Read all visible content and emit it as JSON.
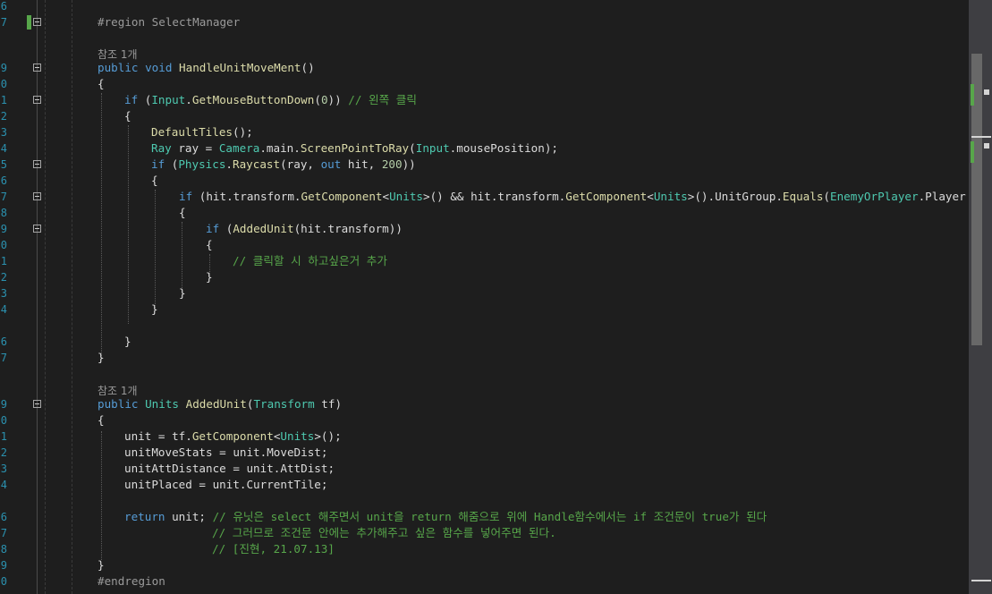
{
  "editor": {
    "line_numbers": [
      "6",
      "7",
      "",
      "9",
      "0",
      "1",
      "2",
      "3",
      "4",
      "5",
      "6",
      "7",
      "8",
      "9",
      "0",
      "1",
      "2",
      "3",
      "4",
      "",
      "6",
      "7",
      "",
      "9",
      "0",
      "1",
      "2",
      "3",
      "4",
      "",
      "6",
      "7",
      "8",
      "9",
      "0"
    ],
    "region_label": "#region SelectManager",
    "endregion_label": "#endregion",
    "reference_label_1": "참조 1개",
    "reference_label_2": "참조 1개",
    "comment_left_click": "// 왼쪽 클릭",
    "comment_on_click": "// 클릭할 시 하고싶은거 추가",
    "comment_return_1": "// 유닛은 select 해주면서 unit을 return 해줌으로 위에 Handle함수에서는 if 조건문이 true가 된다",
    "comment_return_2": "// 그러므로 조건문 안에는 추가해주고 싶은 함수를 넣어주면 된다.",
    "comment_return_3": "// [진현, 21.07.13]",
    "raycast_distance": "200",
    "mouse_button": "0"
  },
  "colors": {
    "background": "#1e1e1e",
    "keyword": "#569cd6",
    "type": "#4ec9b0",
    "method": "#dcdcaa",
    "comment": "#57a64a",
    "line_number": "#2b91af",
    "plain": "#dcdcdc"
  }
}
